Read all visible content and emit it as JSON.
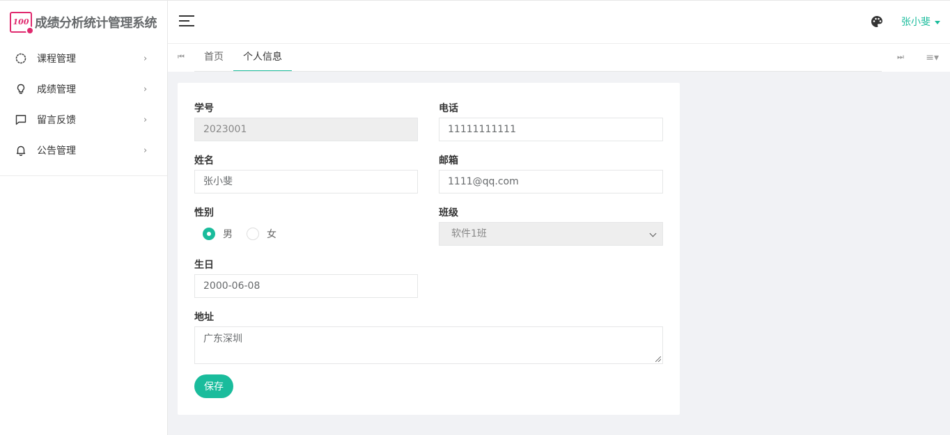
{
  "app": {
    "title": "成绩分析统计管理系统",
    "logo_text": "100",
    "accent_color": "#1abc9c",
    "logo_color": "#e0296e"
  },
  "sidebar": {
    "items": [
      {
        "label": "课程管理",
        "icon": "circle-icon"
      },
      {
        "label": "成绩管理",
        "icon": "lightbulb-icon"
      },
      {
        "label": "留言反馈",
        "icon": "message-icon"
      },
      {
        "label": "公告管理",
        "icon": "bell-icon"
      }
    ],
    "arrow": "›"
  },
  "header": {
    "username": "张小斐"
  },
  "tabs": {
    "first_icon": "⏮",
    "last_icon": "⏭",
    "menu_icon": "≡▾",
    "items": [
      {
        "label": "首页",
        "active": false
      },
      {
        "label": "个人信息",
        "active": true
      }
    ]
  },
  "form": {
    "student_id": {
      "label": "学号",
      "value": "2023001"
    },
    "phone": {
      "label": "电话",
      "value": "11111111111"
    },
    "name": {
      "label": "姓名",
      "value": "张小斐"
    },
    "email": {
      "label": "邮箱",
      "value": "1111@qq.com"
    },
    "gender": {
      "label": "性别",
      "options": [
        "男",
        "女"
      ],
      "selected": "男"
    },
    "class": {
      "label": "班级",
      "value": "软件1班"
    },
    "birthday": {
      "label": "生日",
      "value": "2000-06-08"
    },
    "address": {
      "label": "地址",
      "value": "广东深圳"
    },
    "save_label": "保存"
  }
}
